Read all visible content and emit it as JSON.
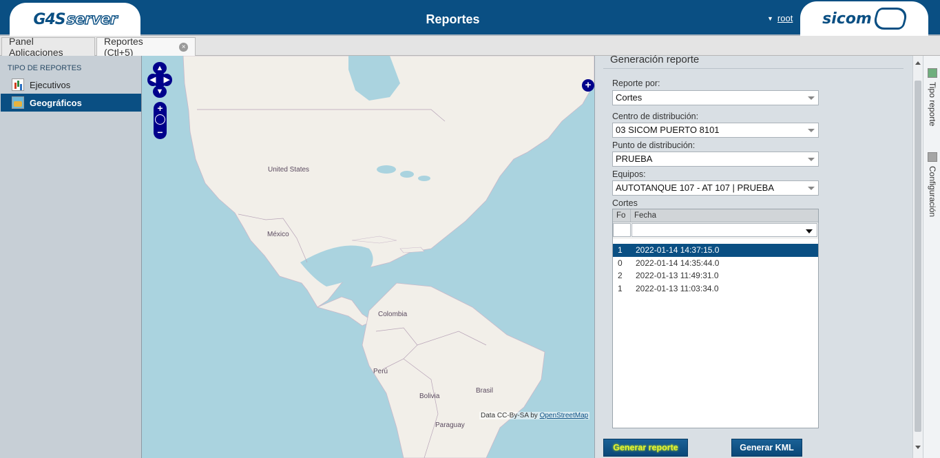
{
  "header": {
    "logo_left_a": "G4S",
    "logo_left_b": "server",
    "title": "Reportes",
    "user": "root",
    "logo_right": "sicom"
  },
  "tabs": [
    {
      "label": "Panel Aplicaciones"
    },
    {
      "label": "Reportes (Ctl+5)"
    }
  ],
  "sidebar": {
    "heading": "TIPO DE REPORTES",
    "items": [
      {
        "label": "Ejecutivos",
        "icon": "bar-chart-icon"
      },
      {
        "label": "Geográficos",
        "icon": "map-icon",
        "selected": true
      }
    ]
  },
  "map": {
    "labels": {
      "us": "United States",
      "mx": "México",
      "co": "Colombia",
      "pe": "Perú",
      "bo": "Bolivia",
      "br": "Brasil",
      "py": "Paraguay"
    },
    "attribution_prefix": "Data CC-By-SA by",
    "attribution_link": "OpenStreetMap"
  },
  "form": {
    "section_title": "Generación reporte",
    "report_by_label": "Reporte por:",
    "report_by_value": "Cortes",
    "center_label": "Centro de distribución:",
    "center_value": "03  SICOM PUERTO 8101",
    "point_label": "Punto de distribución:",
    "point_value": "PRUEBA",
    "equip_label": "Equipos:",
    "equip_value": "AUTOTANQUE 107 - AT 107 | PRUEBA",
    "cuts_label": "Cortes",
    "grid": {
      "col_fo": "Fo",
      "col_fecha": "Fecha",
      "rows": [
        {
          "fo": "1",
          "fecha": "2022-01-14 14:37:15.0",
          "selected": true
        },
        {
          "fo": "0",
          "fecha": "2022-01-14 14:35:44.0"
        },
        {
          "fo": "2",
          "fecha": "2022-01-13 11:49:31.0"
        },
        {
          "fo": "1",
          "fecha": "2022-01-13 11:03:34.0"
        }
      ]
    },
    "btn_generate": "Generar reporte",
    "btn_kml": "Generar KML"
  },
  "sidetabs": {
    "tipo": "Tipo reporte",
    "config": "Configuración"
  },
  "colors": {
    "brand": "#0a4f83",
    "water": "#aad3df",
    "land": "#f2efe9"
  }
}
